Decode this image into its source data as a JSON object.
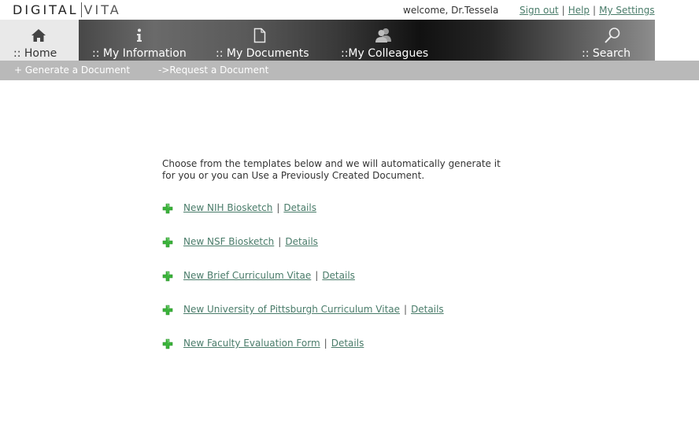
{
  "brand": {
    "part1": "DIGITAL",
    "part2": "VITA"
  },
  "header": {
    "welcome": "welcome, Dr.Tessela",
    "links": [
      "Sign out",
      "Help",
      "My Settings"
    ]
  },
  "nav": {
    "tabs": [
      {
        "label": ":: Home",
        "icon": "home-icon"
      },
      {
        "label": ":: My Information",
        "icon": "info-icon"
      },
      {
        "label": ":: My Documents",
        "icon": "document-icon"
      },
      {
        "label": "::My Colleagues",
        "icon": "colleagues-icon"
      },
      {
        "label": ":: Search",
        "icon": "search-icon"
      }
    ]
  },
  "subnav": {
    "items": [
      "+ Generate a Document",
      "->Request a Document"
    ]
  },
  "main": {
    "intro": "Choose from the templates below and we will automatically generate it for you or you can Use a Previously Created Document.",
    "details_label": "Details",
    "templates": [
      "New NIH Biosketch",
      "New NSF Biosketch",
      "New Brief Curriculum Vitae",
      "New University of Pittsburgh Curriculum Vitae",
      "New Faculty Evaluation Form"
    ]
  },
  "colors": {
    "link": "#4a7c6a",
    "plus_icon": "#3bb33b",
    "subnav_bg": "#b9b9b9"
  }
}
